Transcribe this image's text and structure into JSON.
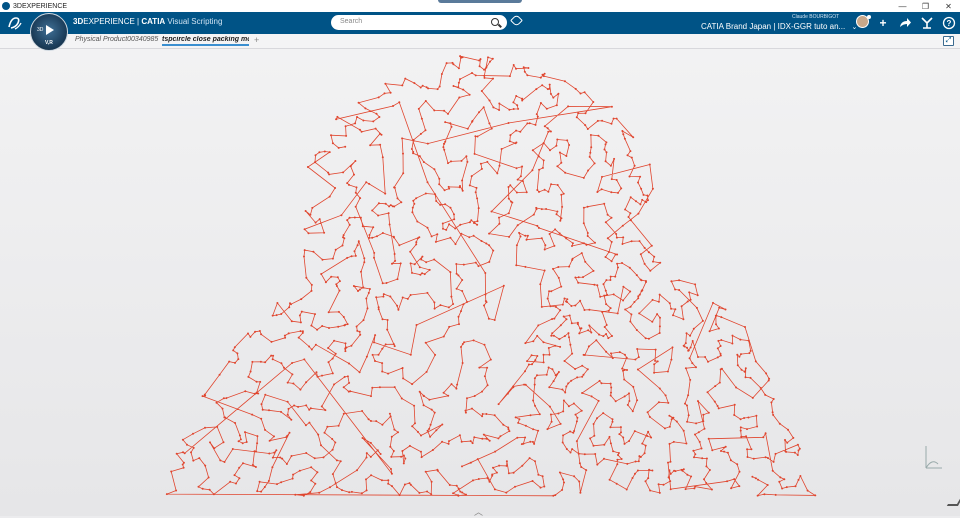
{
  "window": {
    "title": "3DEXPERIENCE",
    "controls": [
      "—",
      "❐",
      "✕"
    ]
  },
  "topbar": {
    "compass_3d": "3D",
    "compass_version": "V,R",
    "brand_part1": "3D",
    "brand_part2": "EXPERIENCE",
    "brand_sep": " | ",
    "brand_part3": "CATIA",
    "brand_app": " Visual Scripting",
    "search_placeholder": "Search",
    "user_name": "Claude BOURBIGOT",
    "tenant": "CATIA Brand Japan | IDX-GGR tuto an...",
    "icons": [
      "tag-icon",
      "add-icon",
      "share-icon",
      "apps-icon",
      "help-icon"
    ],
    "accent": "#005386"
  },
  "tabs": {
    "items": [
      {
        "label": "Physical Product00340985"
      },
      {
        "label": "tspcircle close packing mo"
      }
    ],
    "add_label": "+"
  },
  "viewport": {
    "stroke_color": "#e0452e",
    "description_shape": "tsp-path"
  }
}
